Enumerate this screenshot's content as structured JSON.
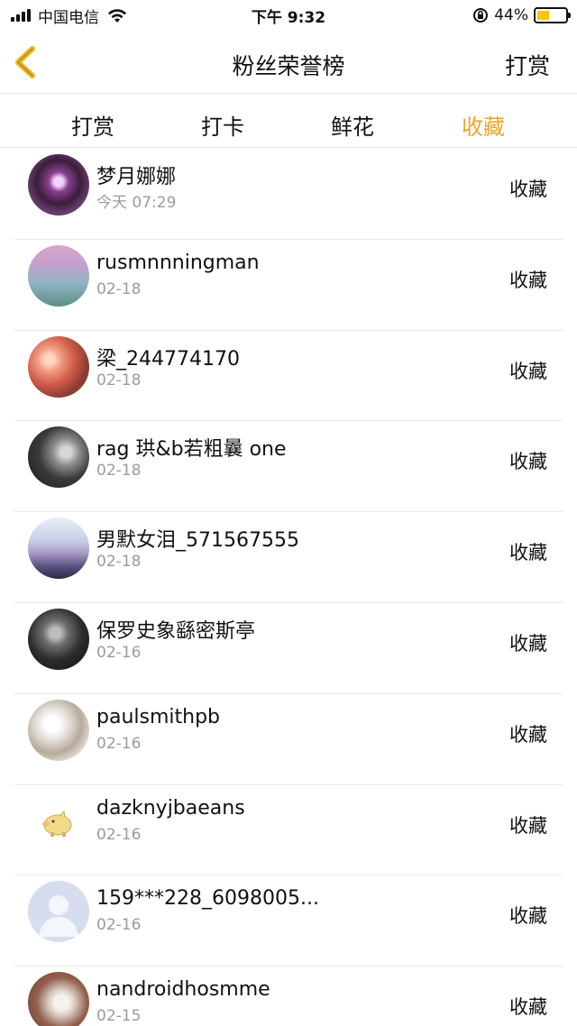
{
  "status_bar": {
    "carrier": "中国电信",
    "time": "下午 9:32",
    "battery_percent": "44%",
    "battery_level": 0.44,
    "icons": [
      "signal-icon",
      "wifi-icon",
      "rotation-lock-icon",
      "battery-icon"
    ],
    "battery_color": "#f7c600"
  },
  "nav": {
    "title": "粉丝荣誉榜",
    "action_label": "打赏",
    "back_icon": "chevron-left-icon",
    "back_icon_color": "#f0b21b"
  },
  "tabs": {
    "items": [
      {
        "label": "打赏"
      },
      {
        "label": "打卡"
      },
      {
        "label": "鲜花"
      },
      {
        "label": "收藏"
      }
    ],
    "active_index": 3,
    "active_color": "#f0a429"
  },
  "list": {
    "items": [
      {
        "name": "梦月娜娜",
        "date": "今天 07:29",
        "action": "收藏"
      },
      {
        "name": "rusmnnningman",
        "date": "02-18",
        "action": "收藏"
      },
      {
        "name": "梁_244774170",
        "date": "02-18",
        "action": "收藏"
      },
      {
        "name": "rag 珙&b若粗曩 one",
        "date": "02-18",
        "action": "收藏"
      },
      {
        "name": "男默女泪_571567555",
        "date": "02-18",
        "action": "收藏"
      },
      {
        "name": "保罗史象繇密斯亭",
        "date": "02-16",
        "action": "收藏"
      },
      {
        "name": "paulsmithpb",
        "date": "02-16",
        "action": "收藏"
      },
      {
        "name": "dazknyjbaeans",
        "date": "02-16",
        "action": "收藏"
      },
      {
        "name": "159***228_6098005...",
        "date": "02-16",
        "action": "收藏"
      },
      {
        "name": "nandroidhosmme",
        "date": "02-15",
        "action": "收藏"
      }
    ]
  }
}
